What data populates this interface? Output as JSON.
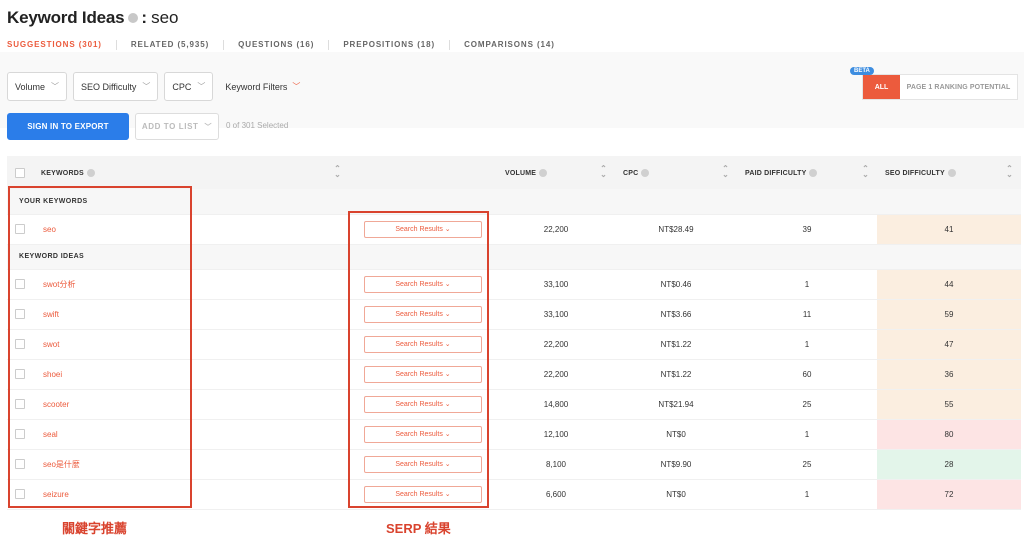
{
  "header": {
    "title": "Keyword Ideas",
    "separator": ":",
    "query": "seo"
  },
  "tabs": [
    {
      "label": "SUGGESTIONS (301)",
      "active": true
    },
    {
      "label": "RELATED (5,935)",
      "active": false
    },
    {
      "label": "QUESTIONS (16)",
      "active": false
    },
    {
      "label": "PREPOSITIONS (18)",
      "active": false
    },
    {
      "label": "COMPARISONS (14)",
      "active": false
    }
  ],
  "filters": {
    "volume": "Volume",
    "seo_difficulty": "SEO Difficulty",
    "cpc": "CPC",
    "keyword_filters": "Keyword Filters"
  },
  "ranking_toggle": {
    "beta": "BETA",
    "all": "ALL",
    "page1": "PAGE 1 RANKING POTENTIAL"
  },
  "actions": {
    "export": "SIGN IN TO EXPORT",
    "add_to_list": "ADD TO LIST",
    "selected": "0 of 301 Selected"
  },
  "table": {
    "headers": {
      "keywords": "KEYWORDS",
      "volume": "VOLUME",
      "cpc": "CPC",
      "paid_difficulty": "PAID DIFFICULTY",
      "seo_difficulty": "SEO DIFFICULTY"
    },
    "section_your": "YOUR KEYWORDS",
    "section_ideas": "KEYWORD IDEAS",
    "serp_label": "Search Results ⌄",
    "your_rows": [
      {
        "keyword": "seo",
        "volume": "22,200",
        "cpc": "NT$28.49",
        "pd": "39",
        "sd": "41",
        "sd_color": "#fbeee0"
      }
    ],
    "idea_rows": [
      {
        "keyword": "swot分析",
        "volume": "33,100",
        "cpc": "NT$0.46",
        "pd": "1",
        "sd": "44",
        "sd_color": "#fbeee0"
      },
      {
        "keyword": "swift",
        "volume": "33,100",
        "cpc": "NT$3.66",
        "pd": "11",
        "sd": "59",
        "sd_color": "#fbeee0"
      },
      {
        "keyword": "swot",
        "volume": "22,200",
        "cpc": "NT$1.22",
        "pd": "1",
        "sd": "47",
        "sd_color": "#fbeee0"
      },
      {
        "keyword": "shoei",
        "volume": "22,200",
        "cpc": "NT$1.22",
        "pd": "60",
        "sd": "36",
        "sd_color": "#fbeee0"
      },
      {
        "keyword": "scooter",
        "volume": "14,800",
        "cpc": "NT$21.94",
        "pd": "25",
        "sd": "55",
        "sd_color": "#fbeee0"
      },
      {
        "keyword": "seal",
        "volume": "12,100",
        "cpc": "NT$0",
        "pd": "1",
        "sd": "80",
        "sd_color": "#fde4e4"
      },
      {
        "keyword": "seo是什麼",
        "volume": "8,100",
        "cpc": "NT$9.90",
        "pd": "25",
        "sd": "28",
        "sd_color": "#e3f5ea"
      },
      {
        "keyword": "seizure",
        "volume": "6,600",
        "cpc": "NT$0",
        "pd": "1",
        "sd": "72",
        "sd_color": "#fde4e4"
      }
    ]
  },
  "annotations": {
    "keyword_label": "關鍵字推薦",
    "serp_label": "SERP 結果",
    "color": "#d9432e"
  }
}
